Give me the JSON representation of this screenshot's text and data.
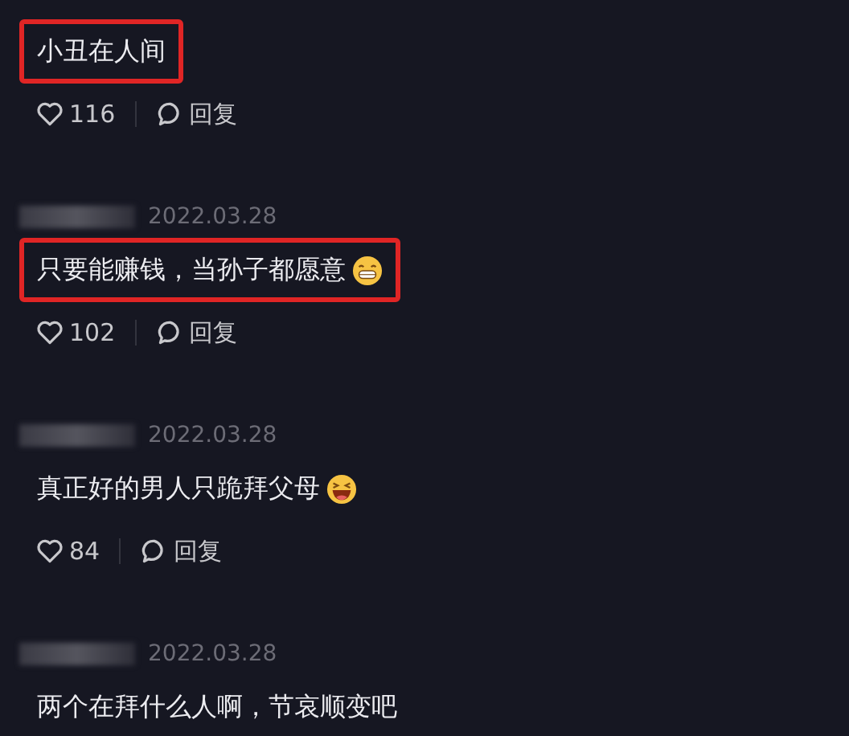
{
  "comments": [
    {
      "kind": "plain",
      "text": "小丑在人间",
      "highlighted": true,
      "likes": "116",
      "reply": "回复"
    },
    {
      "kind": "grin-emoji",
      "date": "2022.03.28",
      "text": "只要能赚钱，当孙子都愿意",
      "highlighted": true,
      "likes": "102",
      "reply": "回复"
    },
    {
      "kind": "laugh-emoji",
      "date": "2022.03.28",
      "text": "真正好的男人只跪拜父母",
      "highlighted": false,
      "likes": "84",
      "reply": "回复"
    },
    {
      "kind": "plain",
      "date": "2022.03.28",
      "text": "两个在拜什么人啊，节哀顺变吧",
      "highlighted": false
    }
  ]
}
